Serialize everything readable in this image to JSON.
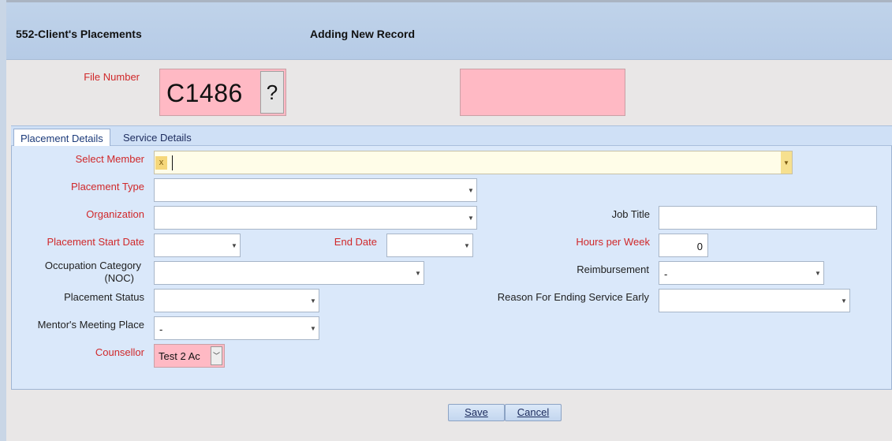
{
  "header": {
    "title": "552-Client's Placements",
    "mode": "Adding New Record"
  },
  "file_number": {
    "label": "File Number",
    "value": "C1486",
    "lookup_label": "?"
  },
  "tabs": [
    {
      "label": "Placement Details",
      "active": true
    },
    {
      "label": "Service Details",
      "active": false
    }
  ],
  "fields": {
    "select_member": {
      "label": "Select Member",
      "chip": "x",
      "value": ""
    },
    "placement_type": {
      "label": "Placement Type",
      "value": ""
    },
    "organization": {
      "label": "Organization",
      "value": ""
    },
    "placement_start_date": {
      "label": "Placement Start Date",
      "value": ""
    },
    "end_date": {
      "label": "End Date",
      "value": ""
    },
    "occupation_category": {
      "label": "Occupation Category (NOC)",
      "label_line1": "Occupation Category",
      "label_line2": "(NOC)",
      "value": ""
    },
    "placement_status": {
      "label": "Placement Status",
      "value": ""
    },
    "mentors_meeting_place": {
      "label": "Mentor's Meeting Place",
      "value": "-"
    },
    "counsellor": {
      "label": "Counsellor",
      "value": "Test 2 Ac"
    },
    "job_title": {
      "label": "Job Title",
      "value": ""
    },
    "hours_per_week": {
      "label": "Hours per Week",
      "value": "0"
    },
    "reimbursement": {
      "label": "Reimbursement",
      "value": "-"
    },
    "reason_for_ending": {
      "label": "Reason For Ending Service Early",
      "value": ""
    }
  },
  "buttons": {
    "save": "Save",
    "cancel": "Cancel"
  },
  "colors": {
    "required_label": "#d0282a",
    "mandatory_field_bg": "#ffb9c4",
    "header_bg": "#b6cbe6",
    "panel_bg": "#dae8fa"
  }
}
